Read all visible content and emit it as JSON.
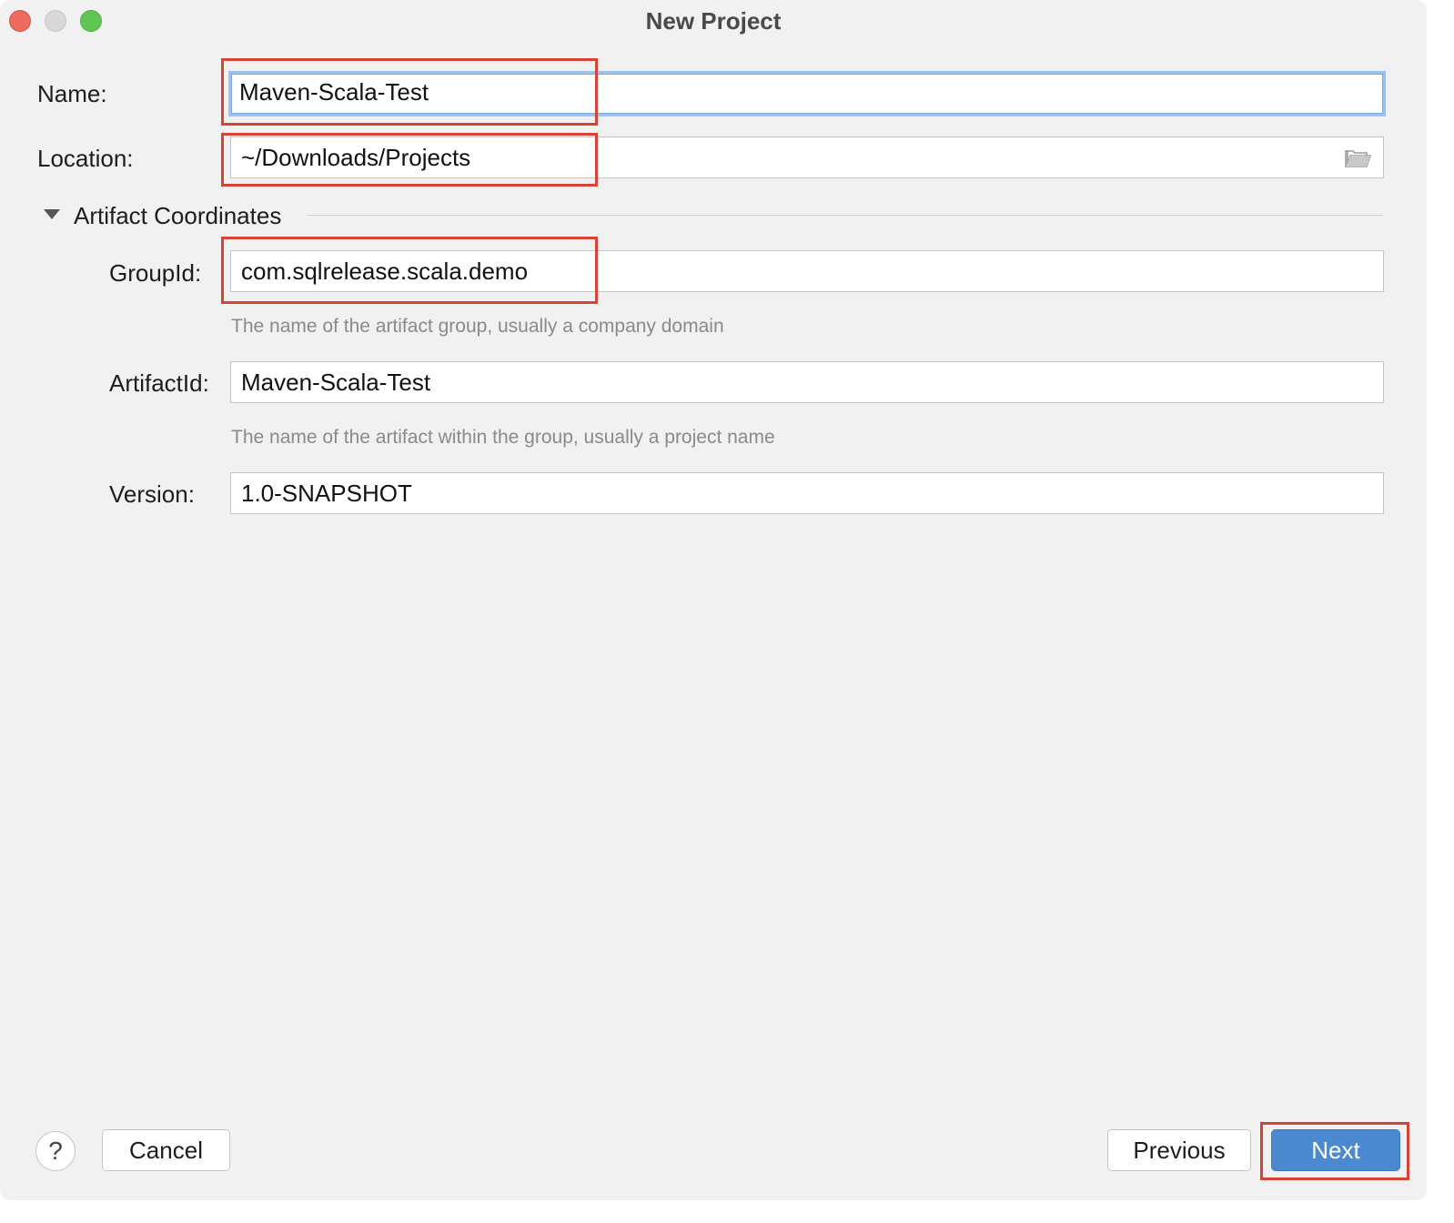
{
  "window": {
    "title": "New Project"
  },
  "form": {
    "name": {
      "label": "Name:",
      "value": "Maven-Scala-Test"
    },
    "location": {
      "label": "Location:",
      "value": "~/Downloads/Projects",
      "browse_icon": "folder-icon"
    },
    "section": {
      "title": "Artifact Coordinates",
      "expanded": true
    },
    "group_id": {
      "label": "GroupId:",
      "value": "com.sqlrelease.scala.demo",
      "hint": "The name of the artifact group, usually a company domain"
    },
    "artifact_id": {
      "label": "ArtifactId:",
      "value": "Maven-Scala-Test",
      "hint": "The name of the artifact within the group, usually a project name"
    },
    "version": {
      "label": "Version:",
      "value": "1.0-SNAPSHOT"
    }
  },
  "footer": {
    "help_label": "?",
    "cancel_label": "Cancel",
    "previous_label": "Previous",
    "next_label": "Next"
  },
  "colors": {
    "highlight": "#d64534",
    "primary_button": "#4b89d0",
    "focus_ring": "#9cc3ef",
    "background": "#f2f1f2"
  }
}
